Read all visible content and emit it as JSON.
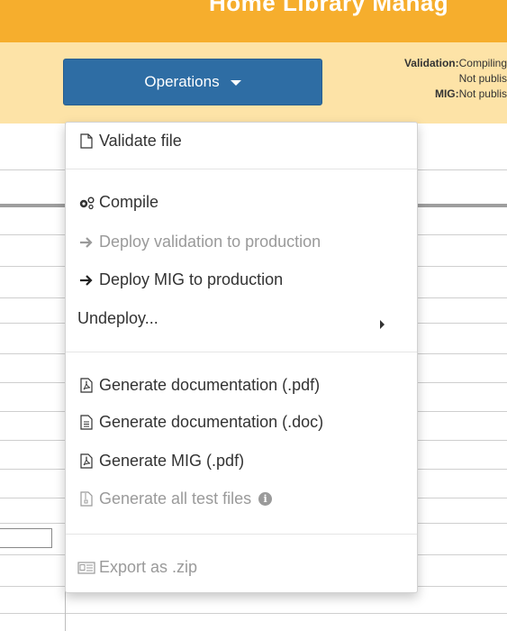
{
  "header": {
    "title": "Home   Library Manag"
  },
  "toolbar": {
    "operations_label": "Operations",
    "status": {
      "validation_label": "Validation:",
      "validation_value": "Compiling",
      "validation_line2": "Not publis",
      "mig_label": "MIG:",
      "mig_value": "Not publis"
    }
  },
  "menu": {
    "items": [
      {
        "label": "Validate file",
        "icon": "file-icon",
        "enabled": true
      },
      {
        "label": "Compile",
        "icon": "cogs-icon",
        "enabled": true
      },
      {
        "label": "Deploy validation to production",
        "icon": "arrow-right-icon",
        "enabled": false
      },
      {
        "label": "Deploy MIG to production",
        "icon": "arrow-right-icon",
        "enabled": true
      },
      {
        "label": "Undeploy...",
        "icon": "submenu-caret-icon",
        "enabled": true
      },
      {
        "label": "Generate documentation (.pdf)",
        "icon": "pdf-file-icon",
        "enabled": true
      },
      {
        "label": "Generate documentation (.doc)",
        "icon": "doc-file-icon",
        "enabled": true
      },
      {
        "label": "Generate MIG (.pdf)",
        "icon": "pdf-file-icon",
        "enabled": true
      },
      {
        "label": "Generate all test files",
        "icon": "archive-file-icon",
        "enabled": false
      },
      {
        "label": "Export as .zip",
        "icon": "zip-card-icon",
        "enabled": false
      }
    ]
  },
  "colors": {
    "topbar": "#f6ae2d",
    "toolbar": "#fde3a7",
    "primary_button": "#2e6da4",
    "disabled_text": "#9a9a9a"
  }
}
